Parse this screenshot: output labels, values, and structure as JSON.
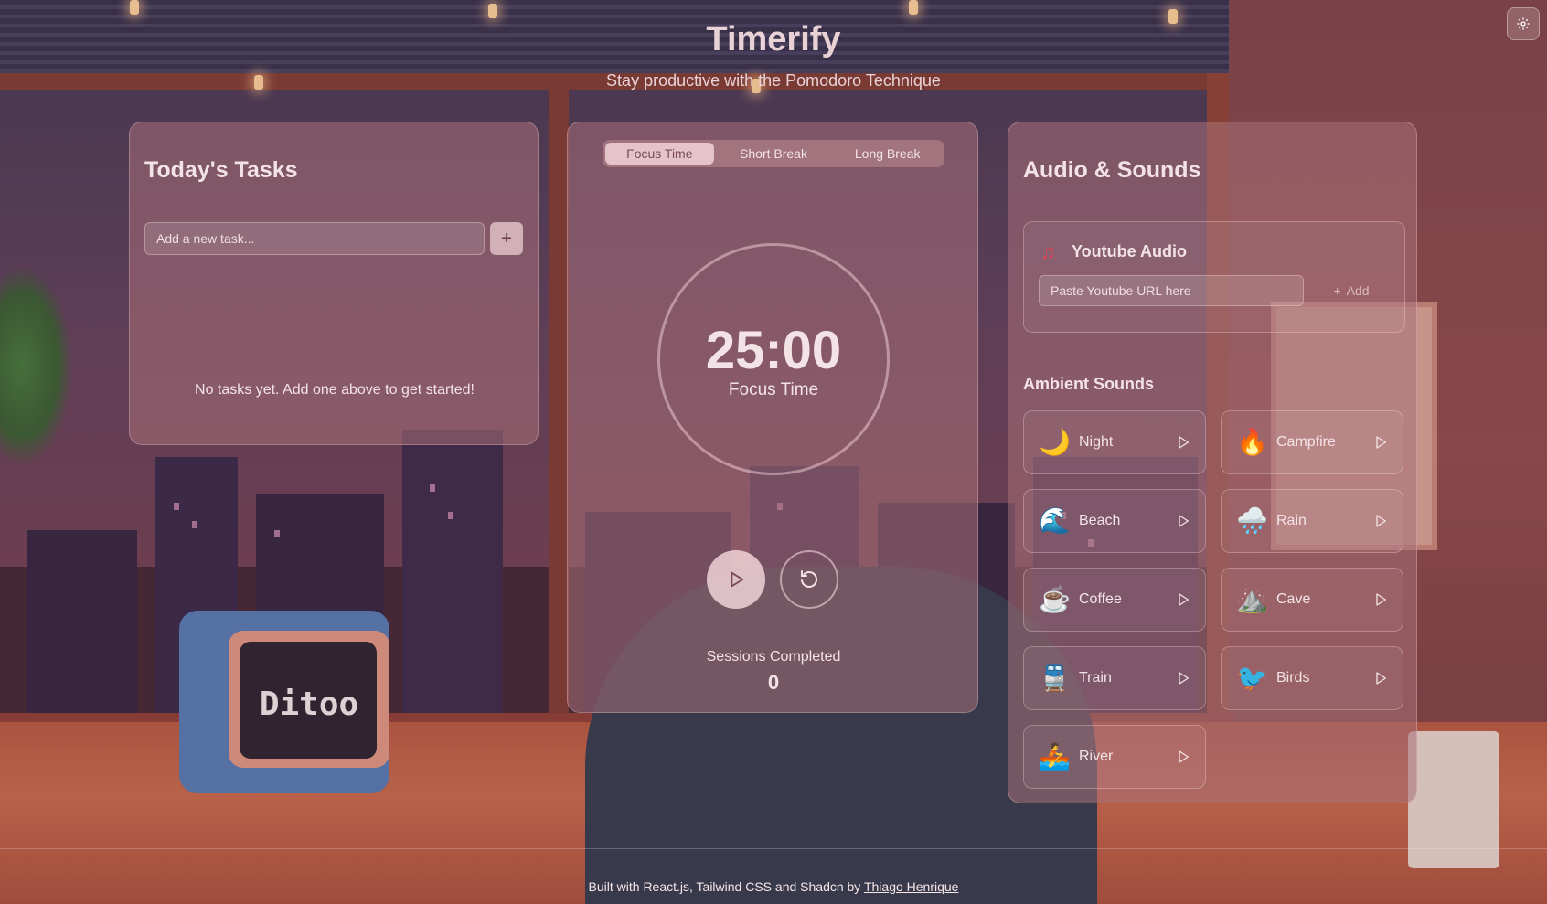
{
  "header": {
    "title": "Timerify",
    "subtitle": "Stay productive with the Pomodoro Technique",
    "settings_icon": "gear-icon"
  },
  "tasks": {
    "title": "Today's Tasks",
    "input_placeholder": "Add a new task...",
    "add_button_label": "+",
    "empty_message": "No tasks yet. Add one above to get started!"
  },
  "timer": {
    "tabs": [
      "Focus Time",
      "Short Break",
      "Long Break"
    ],
    "active_tab": "Focus Time",
    "time": "25:00",
    "mode_label": "Focus Time",
    "sessions_label": "Sessions Completed",
    "sessions_count": "0"
  },
  "audio": {
    "title": "Audio & Sounds",
    "youtube": {
      "title": "Youtube Audio",
      "icon": "music-note-icon",
      "input_placeholder": "Paste Youtube URL here",
      "add_label": "Add"
    },
    "ambient_title": "Ambient Sounds",
    "sounds": [
      {
        "label": "Night",
        "emoji": "🌙"
      },
      {
        "label": "Campfire",
        "emoji": "🔥"
      },
      {
        "label": "Beach",
        "emoji": "🌊"
      },
      {
        "label": "Rain",
        "emoji": "🌧️"
      },
      {
        "label": "Coffee",
        "emoji": "☕"
      },
      {
        "label": "Cave",
        "emoji": "⛰️"
      },
      {
        "label": "Train",
        "emoji": "🚆"
      },
      {
        "label": "Birds",
        "emoji": "🐦"
      },
      {
        "label": "River",
        "emoji": "🚣"
      }
    ]
  },
  "footer": {
    "text": "Built with React.js, Tailwind CSS and Shadcn by ",
    "author": "Thiago Henrique"
  },
  "colors": {
    "panel": "#a87078",
    "accent": "#f0d2d7",
    "music_icon": "#e2455a"
  }
}
